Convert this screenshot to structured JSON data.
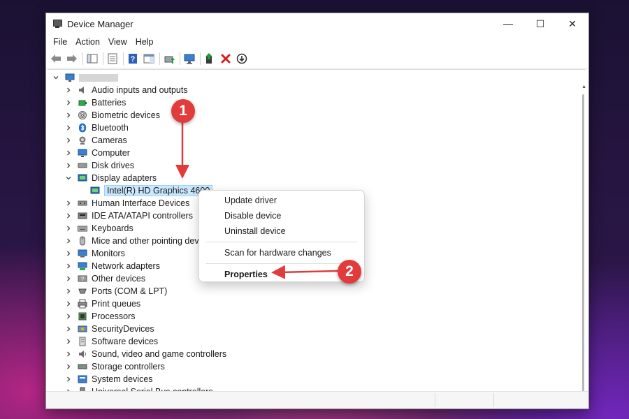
{
  "window": {
    "title": "Device Manager",
    "controls": {
      "minimize": "—",
      "maximize": "☐",
      "close": "✕"
    }
  },
  "menubar": [
    "File",
    "Action",
    "View",
    "Help"
  ],
  "toolbar": {
    "icons": [
      "back-arrow-icon",
      "forward-arrow-icon",
      "show-hide-console-tree-icon",
      "properties-sheet-icon",
      "help-icon",
      "show-action-pane-icon",
      "update-driver-icon",
      "scan-hardware-icon",
      "enable-device-icon",
      "uninstall-device-icon",
      "download-icon"
    ]
  },
  "tree": {
    "root": "",
    "categories": [
      {
        "label": "Audio inputs and outputs",
        "icon": "speaker-icon"
      },
      {
        "label": "Batteries",
        "icon": "battery-icon"
      },
      {
        "label": "Biometric devices",
        "icon": "fingerprint-icon"
      },
      {
        "label": "Bluetooth",
        "icon": "bluetooth-icon"
      },
      {
        "label": "Cameras",
        "icon": "camera-icon"
      },
      {
        "label": "Computer",
        "icon": "computer-icon"
      },
      {
        "label": "Disk drives",
        "icon": "disk-drive-icon"
      },
      {
        "label": "Display adapters",
        "icon": "display-adapter-icon",
        "expanded": true
      },
      {
        "label": "Human Interface Devices",
        "icon": "hid-icon"
      },
      {
        "label": "IDE ATA/ATAPI controllers",
        "icon": "ide-controller-icon"
      },
      {
        "label": "Keyboards",
        "icon": "keyboard-icon"
      },
      {
        "label": "Mice and other pointing devi",
        "icon": "mouse-icon"
      },
      {
        "label": "Monitors",
        "icon": "monitor-icon"
      },
      {
        "label": "Network adapters",
        "icon": "network-adapter-icon"
      },
      {
        "label": "Other devices",
        "icon": "other-devices-icon"
      },
      {
        "label": "Ports (COM & LPT)",
        "icon": "port-icon"
      },
      {
        "label": "Print queues",
        "icon": "printer-icon"
      },
      {
        "label": "Processors",
        "icon": "processor-icon"
      },
      {
        "label": "SecurityDevices",
        "icon": "security-device-icon"
      },
      {
        "label": "Software devices",
        "icon": "software-device-icon"
      },
      {
        "label": "Sound, video and game controllers",
        "icon": "sound-controller-icon"
      },
      {
        "label": "Storage controllers",
        "icon": "storage-controller-icon"
      },
      {
        "label": "System devices",
        "icon": "system-device-icon"
      },
      {
        "label": "Universal Serial Bus controllers",
        "icon": "usb-icon"
      }
    ],
    "display_child": "Intel(R) HD Graphics 4600"
  },
  "context_menu": {
    "items": [
      "Update driver",
      "Disable device",
      "Uninstall device",
      "Scan for hardware changes",
      "Properties"
    ]
  },
  "annotations": {
    "badge_1": "1",
    "badge_2": "2",
    "color": "#e23b3b"
  }
}
